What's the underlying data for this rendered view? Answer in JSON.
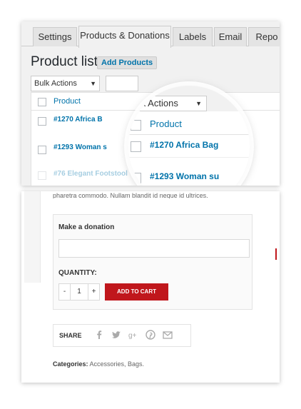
{
  "tabs": [
    {
      "label": "Settings"
    },
    {
      "label": "Products & Donations"
    },
    {
      "label": "Labels"
    },
    {
      "label": "Email"
    },
    {
      "label": "Repo"
    }
  ],
  "product_list": {
    "title": "Product list",
    "add_button": "Add Products",
    "bulk_actions": "Bulk Actions",
    "bulk_actions_zoom": "Bulk Actions",
    "column_header": "Product",
    "rows": [
      "#1270 Africa B",
      "#1293 Woman s",
      "#76 Elegant Footstool"
    ],
    "zoom_rows": [
      "#1270 Africa Bag",
      "#1293 Woman su"
    ]
  },
  "donation": {
    "top_text": "pharetra commodo. Nullam blandit id neque id ultrices.",
    "make_label": "Make a donation",
    "donation_value": "",
    "quantity_label": "QUANTITY:",
    "minus": "-",
    "qty": "1",
    "plus": "+",
    "add_to_cart": "ADD TO CART",
    "share_label": "SHARE",
    "categories_label": "Categories:",
    "categories_value": " Accessories, Bags."
  },
  "colors": {
    "link": "#0073aa",
    "cart": "#c0171c"
  },
  "icons": [
    "facebook-icon",
    "twitter-icon",
    "google-plus-icon",
    "pinterest-icon",
    "email-icon"
  ]
}
